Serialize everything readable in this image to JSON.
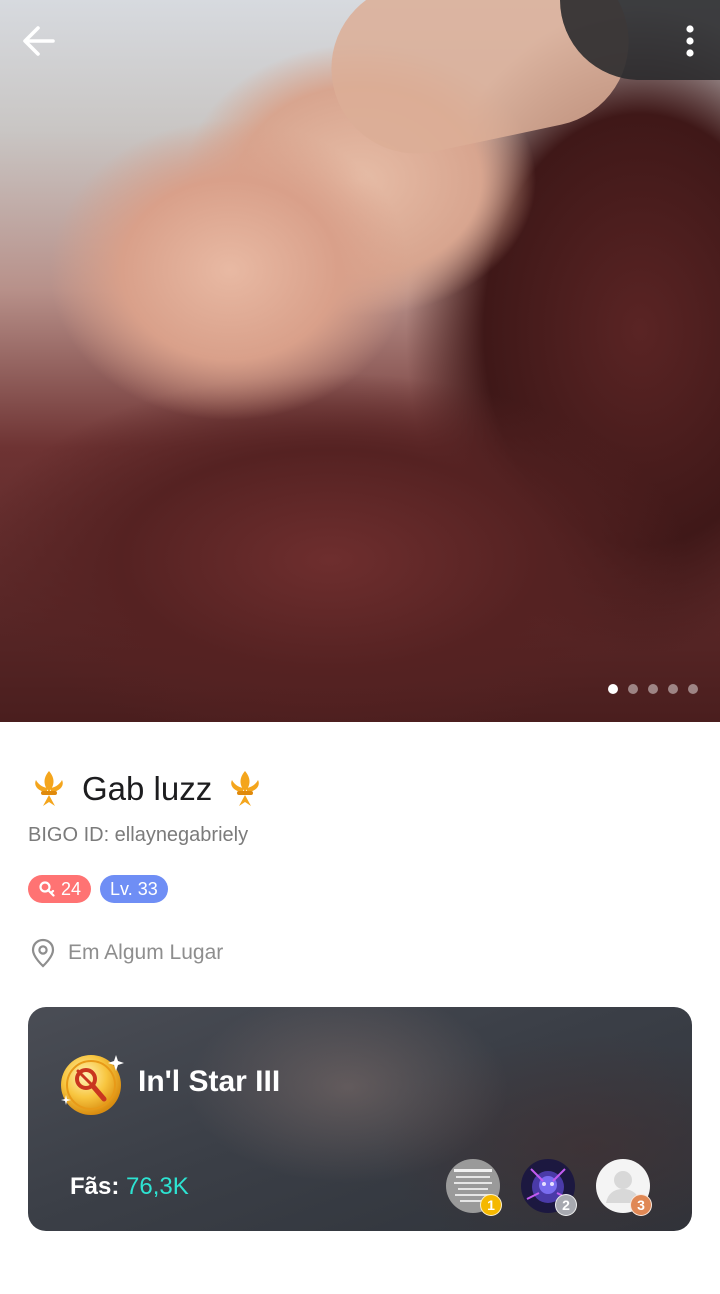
{
  "header": {
    "back_icon": "arrow-left-icon",
    "more_icon": "more-vertical-icon",
    "photo_count": 5,
    "active_photo_index": 0
  },
  "profile": {
    "name": "Gab luzz",
    "name_decoration_icon": "fleur-de-lis-icon",
    "bigo_id": "BIGO ID: ellaynegabriely",
    "rich_badge": "24",
    "level_badge": "Lv. 33",
    "location": "Em Algum Lugar"
  },
  "star_card": {
    "title": "In'l Star III",
    "fans_label": "Fãs:",
    "fans_value": "76,3K",
    "top_fans": [
      {
        "rank": "1",
        "rank_color": "#f5b800"
      },
      {
        "rank": "2",
        "rank_color": "#a7a9b0"
      },
      {
        "rank": "3",
        "rank_color": "#e08855"
      }
    ]
  },
  "colors": {
    "rich_badge": "#ff7373",
    "level_badge": "#6f8ef5",
    "fans_value": "#2de3d2"
  }
}
